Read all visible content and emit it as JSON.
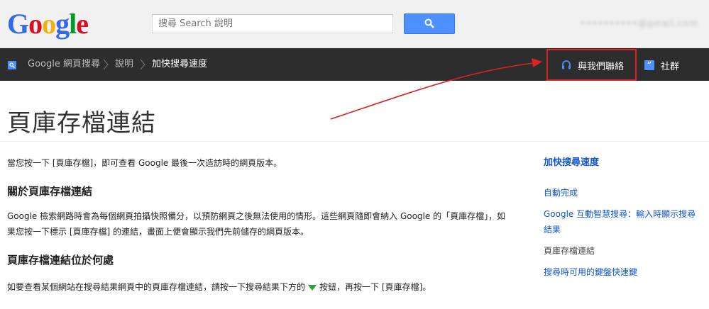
{
  "header": {
    "logo_letters": [
      {
        "ch": "G",
        "color": "#3369e8"
      },
      {
        "ch": "o",
        "color": "#d50f25"
      },
      {
        "ch": "o",
        "color": "#eeb211"
      },
      {
        "ch": "g",
        "color": "#3369e8"
      },
      {
        "ch": "l",
        "color": "#009925"
      },
      {
        "ch": "e",
        "color": "#d50f25"
      }
    ],
    "search_placeholder": "搜尋 Search 說明",
    "account_email": "••••••••••@gmail.com"
  },
  "nav": {
    "breadcrumbs": [
      "Google 網頁搜尋",
      "說明",
      "加快搜尋速度"
    ],
    "contact_label": "與我們聯絡",
    "community_label": "社群",
    "community_icon": "”"
  },
  "content": {
    "title": "頁庫存檔連結",
    "para1": "當您按一下 [頁庫存檔]，即可查看 Google 最後一次造訪時的網頁版本。",
    "heading1": "關於頁庫存檔連結",
    "para2": "Google 檢索網路時會為每個網頁拍攝快照備分，以預防網頁之後無法使用的情形。這些網頁隨即會納入 Google 的「頁庫存檔」，如果您按一下標示 [頁庫存檔] 的連結，畫面上便會顯示我們先前儲存的網頁版本。",
    "heading2": "頁庫存檔連結位於何處",
    "para3_before": "如要查看某個網站在搜尋結果網頁中的頁庫存檔連結，請按一下搜尋結果下方的",
    "para3_after": "按鈕，再按一下 [頁庫存檔]。"
  },
  "sidebar": {
    "heading": "加快搜尋速度",
    "items": [
      {
        "label": "自動完成"
      },
      {
        "label": "Google 互動智慧搜尋：輸入時顯示搜尋結果"
      },
      {
        "label": "頁庫存檔連結"
      },
      {
        "label": "搜尋時可用的鍵盤快速鍵"
      }
    ]
  },
  "colors": {
    "accent_blue": "#4d90fe",
    "link_blue": "#1155cc",
    "annotation_red": "#dd2222",
    "nav_bg": "#2d2d2d"
  }
}
